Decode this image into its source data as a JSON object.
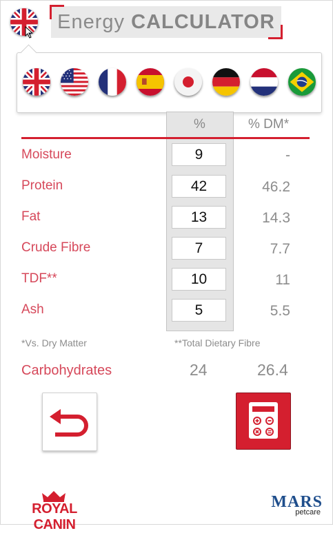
{
  "header": {
    "title_light": "Energy",
    "title_bold": "CALCULATOR",
    "current_flag": "flag-uk-icon"
  },
  "flags": [
    {
      "name": "flag-uk-icon"
    },
    {
      "name": "flag-usa-icon"
    },
    {
      "name": "flag-france-icon"
    },
    {
      "name": "flag-spain-icon"
    },
    {
      "name": "flag-japan-icon"
    },
    {
      "name": "flag-germany-icon"
    },
    {
      "name": "flag-netherlands-icon"
    },
    {
      "name": "flag-brazil-icon"
    }
  ],
  "table": {
    "col_pct": "%",
    "col_dm": "% DM*",
    "rows": [
      {
        "label": "Moisture",
        "value": "9",
        "dm": "-"
      },
      {
        "label": "Protein",
        "value": "42",
        "dm": "46.2"
      },
      {
        "label": "Fat",
        "value": "13",
        "dm": "14.3"
      },
      {
        "label": "Crude Fibre",
        "value": "7",
        "dm": "7.7"
      },
      {
        "label": "TDF**",
        "value": "10",
        "dm": "11"
      },
      {
        "label": "Ash",
        "value": "5",
        "dm": "5.5"
      }
    ]
  },
  "footnotes": {
    "dm": "*Vs. Dry Matter",
    "tdf": "**Total Dietary Fibre"
  },
  "carbohydrates": {
    "label": "Carbohydrates",
    "value": "24",
    "dm": "26.4"
  },
  "buttons": {
    "back_icon": "back-arrow-icon",
    "calc_icon": "calculator-icon"
  },
  "logos": {
    "royal_canin": "ROYAL CANIN",
    "mars": "MARS",
    "mars_sub": "petcare"
  },
  "colors": {
    "accent_red": "#d41f2f",
    "label_red": "#d6485a",
    "grey_text": "#8c8c8c",
    "mars_blue": "#1f4e8c"
  }
}
